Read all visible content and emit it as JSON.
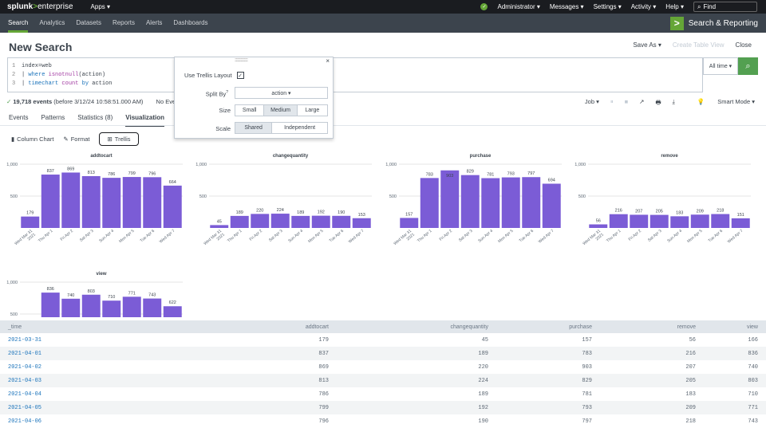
{
  "topbar": {
    "logo_a": "splunk",
    "logo_b": ">",
    "logo_c": "enterprise",
    "apps": "Apps ▾",
    "user": "Administrator ▾",
    "messages": "Messages ▾",
    "settings": "Settings ▾",
    "activity": "Activity ▾",
    "help": "Help ▾",
    "find": "Find"
  },
  "appbar": {
    "items": [
      "Search",
      "Analytics",
      "Datasets",
      "Reports",
      "Alerts",
      "Dashboards"
    ],
    "brand": "Search & Reporting"
  },
  "page": {
    "title": "New Search",
    "save_as": "Save As ▾",
    "create_table": "Create Table View",
    "close": "Close"
  },
  "search": {
    "line1": "index=web",
    "line2_pipe": "| ",
    "line2_kw": "where ",
    "line2_fn": "isnotnull",
    "line2_rest": "(action)",
    "line3_pipe": "| ",
    "line3_kw": "timechart ",
    "line3_fn": "count ",
    "line3_kw2": "by ",
    "line3_rest": "action",
    "time": "All time ▾",
    "go": "🔍"
  },
  "events": {
    "check": "✓",
    "count": "19,718 events",
    "detail": " (before 3/12/24 10:58:51.000 AM)",
    "noevent": "No Even"
  },
  "jobbar": {
    "job": "Job ▾",
    "pause": "⏸",
    "stop": "■",
    "share": "↗",
    "print": "🖶",
    "export": "⤓",
    "mode": "Smart Mode ▾"
  },
  "tabs": [
    "Events",
    "Patterns",
    "Statistics (8)",
    "Visualization"
  ],
  "vizbar": {
    "chart": "Column Chart",
    "format": "Format",
    "trellis": "Trellis"
  },
  "trellis_panel": {
    "grip": "::::::::::::::::::::::::",
    "close": "×",
    "use_label": "Use Trellis Layout",
    "use_check": "✓",
    "split_label": "Split By",
    "split_info": "?",
    "split_value": "action ▾",
    "size_label": "Size",
    "size_opts": [
      "Small",
      "Medium",
      "Large"
    ],
    "scale_label": "Scale",
    "scale_opts": [
      "Shared",
      "Independent"
    ]
  },
  "chart_data": {
    "type": "bar",
    "categories": [
      "Wed Mar 31 2021",
      "Thu Apr 1",
      "Fri Apr 2",
      "Sat Apr 3",
      "Sun Apr 4",
      "Mon Apr 5",
      "Tue Apr 6",
      "Wed Apr 7"
    ],
    "category_lines": [
      [
        "Wed Mar 31",
        "2021"
      ],
      [
        "Thu Apr 1"
      ],
      [
        "Fri Apr 2"
      ],
      [
        "Sat Apr 3"
      ],
      [
        "Sun Apr 4"
      ],
      [
        "Mon Apr 5"
      ],
      [
        "Tue Apr 6"
      ],
      [
        "Wed Apr 7"
      ]
    ],
    "ylim": [
      0,
      1000
    ],
    "yticks": [
      "1,000",
      "500"
    ],
    "color": "#7b5cd6",
    "series": [
      {
        "name": "addtocart",
        "values": [
          179,
          837,
          869,
          813,
          786,
          799,
          796,
          664
        ]
      },
      {
        "name": "changequantity",
        "values": [
          45,
          189,
          220,
          224,
          189,
          192,
          190,
          153
        ]
      },
      {
        "name": "purchase",
        "values": [
          157,
          783,
          903,
          829,
          781,
          793,
          797,
          694
        ]
      },
      {
        "name": "remove",
        "values": [
          56,
          216,
          207,
          205,
          183,
          209,
          218,
          151
        ]
      },
      {
        "name": "view",
        "values": [
          166,
          836,
          740,
          803,
          710,
          771,
          743,
          622
        ]
      }
    ]
  },
  "table": {
    "headers": [
      "_time",
      "addtocart",
      "changequantity",
      "purchase",
      "remove",
      "view"
    ],
    "rows": [
      [
        "2021-03-31",
        "179",
        "45",
        "157",
        "56",
        "166"
      ],
      [
        "2021-04-01",
        "837",
        "189",
        "783",
        "216",
        "836"
      ],
      [
        "2021-04-02",
        "869",
        "220",
        "903",
        "207",
        "740"
      ],
      [
        "2021-04-03",
        "813",
        "224",
        "829",
        "205",
        "803"
      ],
      [
        "2021-04-04",
        "786",
        "189",
        "781",
        "183",
        "710"
      ],
      [
        "2021-04-05",
        "799",
        "192",
        "793",
        "209",
        "771"
      ],
      [
        "2021-04-06",
        "796",
        "190",
        "797",
        "218",
        "743"
      ]
    ]
  }
}
